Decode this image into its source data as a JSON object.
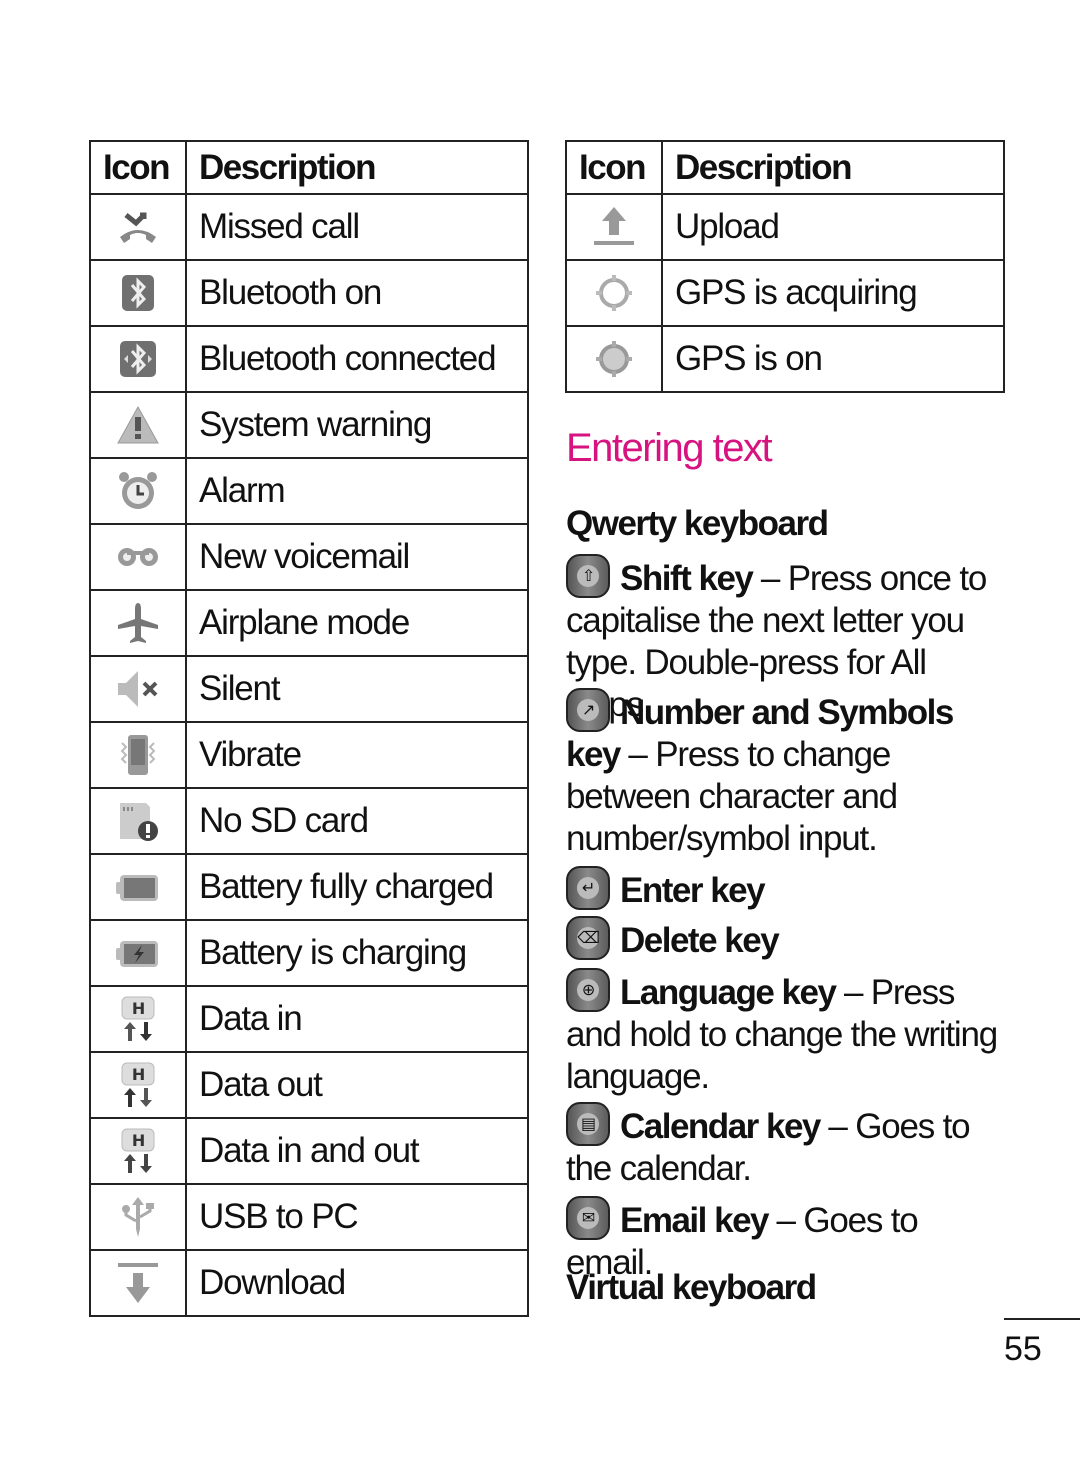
{
  "left_table": {
    "headers": {
      "icon": "Icon",
      "description": "Description"
    },
    "rows": [
      {
        "icon": "missed-call-icon",
        "description": "Missed call"
      },
      {
        "icon": "bluetooth-on-icon",
        "description": "Bluetooth on"
      },
      {
        "icon": "bluetooth-connected-icon",
        "description": "Bluetooth connected"
      },
      {
        "icon": "system-warning-icon",
        "description": "System warning"
      },
      {
        "icon": "alarm-icon",
        "description": "Alarm"
      },
      {
        "icon": "voicemail-icon",
        "description": "New voicemail"
      },
      {
        "icon": "airplane-icon",
        "description": "Airplane mode"
      },
      {
        "icon": "silent-icon",
        "description": "Silent"
      },
      {
        "icon": "vibrate-icon",
        "description": "Vibrate"
      },
      {
        "icon": "no-sd-card-icon",
        "description": "No SD card"
      },
      {
        "icon": "battery-full-icon",
        "description": "Battery fully charged"
      },
      {
        "icon": "battery-charging-icon",
        "description": "Battery is charging"
      },
      {
        "icon": "data-in-icon",
        "description": "Data in"
      },
      {
        "icon": "data-out-icon",
        "description": "Data out"
      },
      {
        "icon": "data-in-out-icon",
        "description": "Data in and out"
      },
      {
        "icon": "usb-icon",
        "description": "USB to PC"
      },
      {
        "icon": "download-icon",
        "description": "Download"
      }
    ]
  },
  "right_table": {
    "headers": {
      "icon": "Icon",
      "description": "Description"
    },
    "rows": [
      {
        "icon": "upload-icon",
        "description": "Upload"
      },
      {
        "icon": "gps-acquiring-icon",
        "description": "GPS is acquiring"
      },
      {
        "icon": "gps-on-icon",
        "description": "GPS is on"
      }
    ]
  },
  "section": {
    "title": "Entering text",
    "title_color": "#d6137f",
    "qwerty_heading": "Qwerty keyboard",
    "keys": [
      {
        "icon": "shift-key-icon",
        "glyph": "⇧",
        "name": "Shift key",
        "text": " – Press once to capitalise the next letter you type. Double-press for All Caps."
      },
      {
        "icon": "number-symbols-key-icon",
        "glyph": "↗",
        "name": "Number and Symbols key",
        "text": " – Press to change between character and number/symbol input."
      },
      {
        "icon": "enter-key-icon",
        "glyph": "↵",
        "name": "Enter key",
        "text": ""
      },
      {
        "icon": "delete-key-icon",
        "glyph": "⌫",
        "name": "Delete key",
        "text": ""
      },
      {
        "icon": "language-key-icon",
        "glyph": "⊕",
        "name": "Language key",
        "text": " – Press and hold to change the writing language."
      },
      {
        "icon": "calendar-key-icon",
        "glyph": "▤",
        "name": "Calendar key",
        "text": " – Goes to the calendar."
      },
      {
        "icon": "email-key-icon",
        "glyph": "✉",
        "name": "Email key",
        "text": " – Goes to email."
      }
    ],
    "virtual_heading": "Virtual keyboard"
  },
  "page_number": "55"
}
